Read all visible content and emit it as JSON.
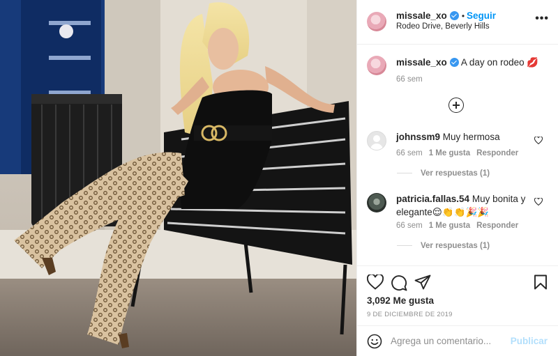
{
  "post": {
    "username": "missale_xo",
    "follow_label": "Seguir",
    "separator": "•",
    "location": "Rodeo Drive, Beverly Hills",
    "more_label": "•••"
  },
  "caption": {
    "username": "missale_xo",
    "text": "A day on rodeo 💋",
    "time": "66 sem"
  },
  "comments": [
    {
      "username": "johnssm9",
      "text": "Muy hermosa",
      "time": "66 sem",
      "likes": "1 Me gusta",
      "reply_label": "Responder",
      "view_replies": "Ver respuestas (1)"
    },
    {
      "username": "patricia.fallas.54",
      "text": "Muy bonita y elegante😌👏👏🎉🎉",
      "time": "66 sem",
      "likes": "1 Me gusta",
      "reply_label": "Responder",
      "view_replies": "Ver respuestas (1)"
    }
  ],
  "stats": {
    "likes": "3,092 Me gusta",
    "date": "9 DE DICIEMBRE DE 2019"
  },
  "comment_box": {
    "placeholder": "Agrega un comentario...",
    "publish_label": "Publicar"
  },
  "icons": {
    "verified": "verified-badge-icon",
    "load_more": "plus-circle-icon",
    "like": "heart-icon",
    "comment": "comment-bubble-icon",
    "share": "paper-plane-icon",
    "save": "bookmark-icon",
    "emoji": "smiley-icon"
  },
  "colors": {
    "link_blue": "#0095f6",
    "publish_disabled": "#b2dffc",
    "muted_text": "#8e8e8e",
    "verified_blue": "#3897f0"
  }
}
